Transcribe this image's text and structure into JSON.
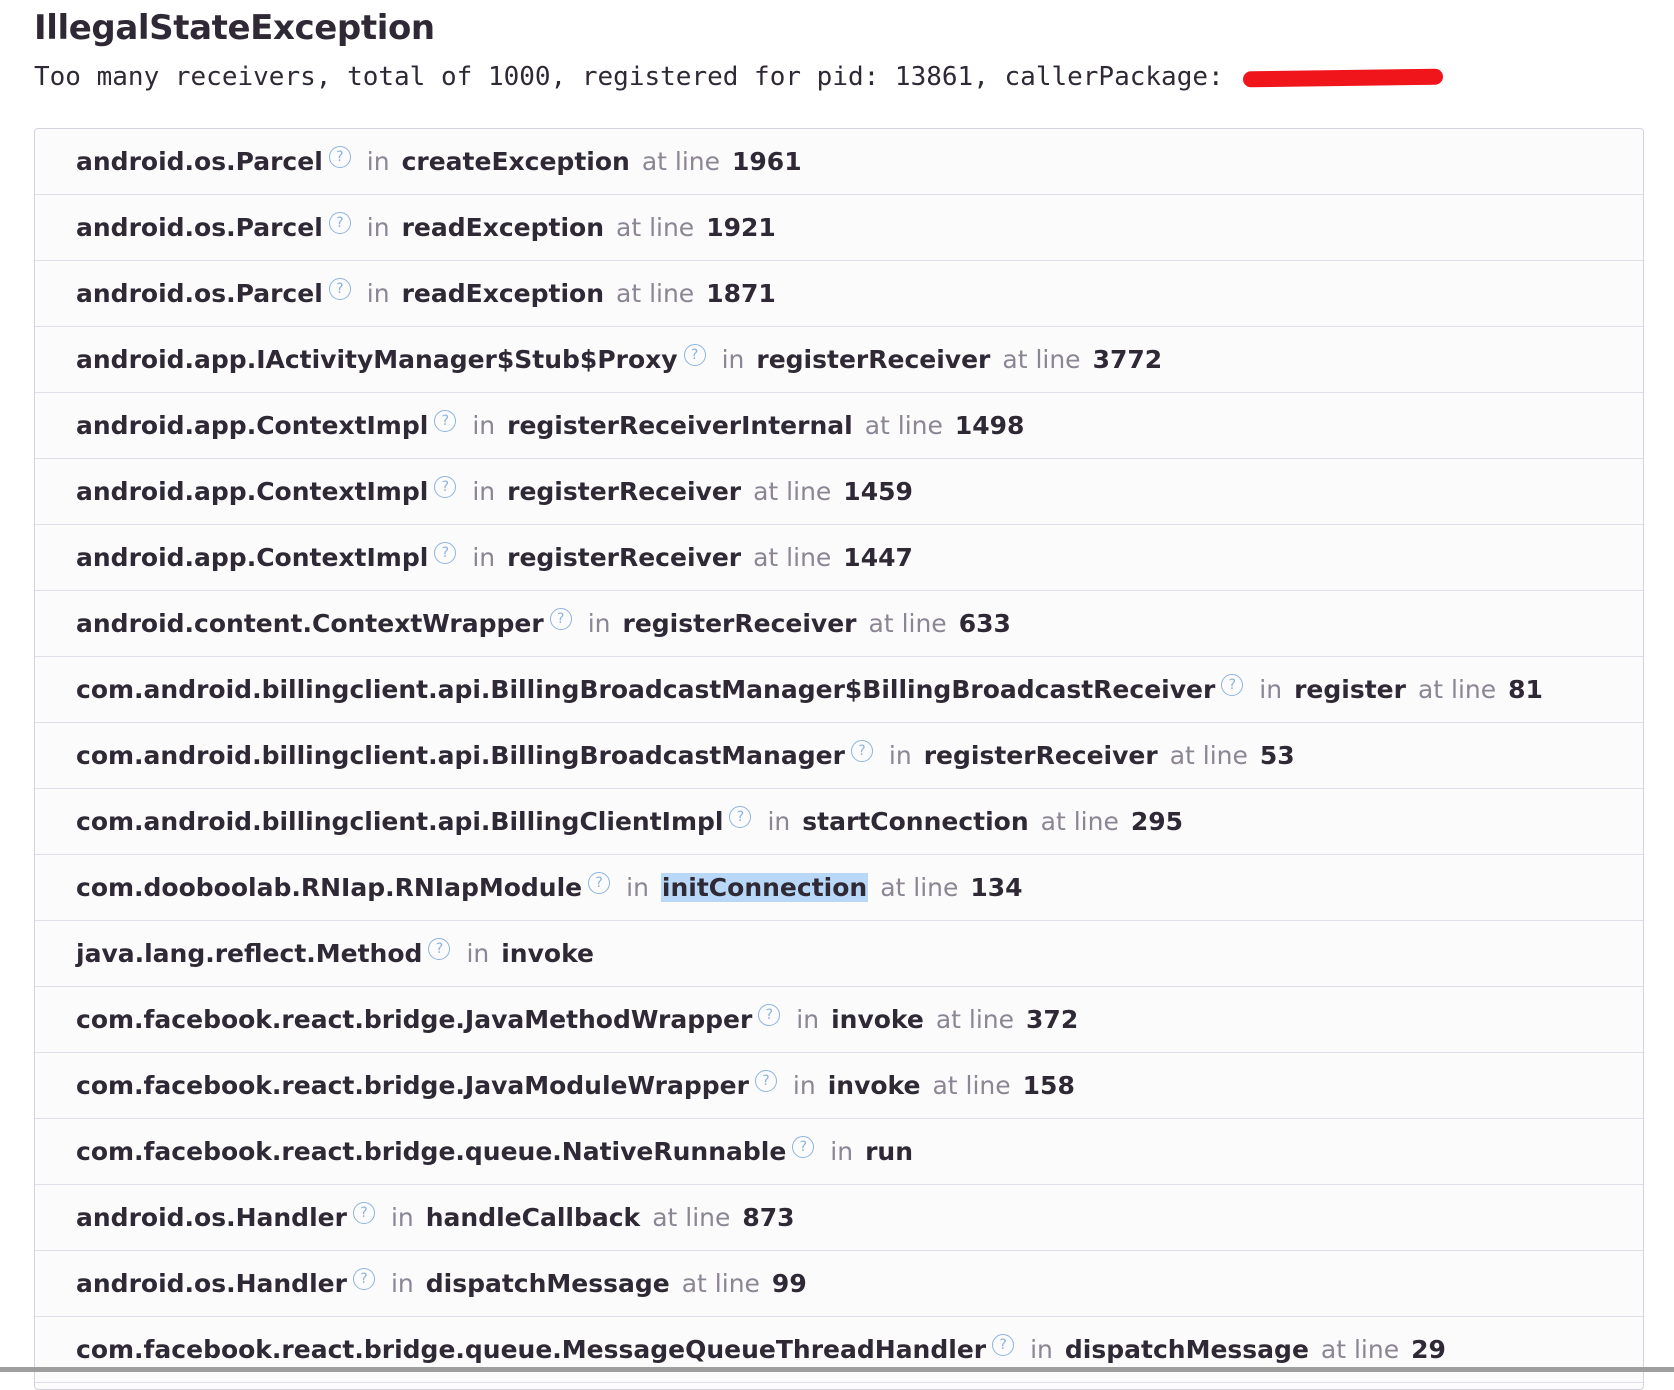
{
  "exception": {
    "type": "IllegalStateException",
    "message": "Too many receivers, total of 1000, registered for pid: 13861, callerPackage: "
  },
  "icons": {
    "help": "?",
    "help_icon_name": "question-circle-icon"
  },
  "labels": {
    "in": "in",
    "at_line": "at line"
  },
  "colors": {
    "text": "#2f2936",
    "muted": "#8b8594",
    "help_icon": "#8eb3dd",
    "selection": "#b9d8f8",
    "redaction": "#f0151b",
    "row_border": "#e2dee7"
  },
  "frames": [
    {
      "module": "android.os.Parcel",
      "function": "createException",
      "line": "1961"
    },
    {
      "module": "android.os.Parcel",
      "function": "readException",
      "line": "1921"
    },
    {
      "module": "android.os.Parcel",
      "function": "readException",
      "line": "1871"
    },
    {
      "module": "android.app.IActivityManager$Stub$Proxy",
      "function": "registerReceiver",
      "line": "3772"
    },
    {
      "module": "android.app.ContextImpl",
      "function": "registerReceiverInternal",
      "line": "1498"
    },
    {
      "module": "android.app.ContextImpl",
      "function": "registerReceiver",
      "line": "1459"
    },
    {
      "module": "android.app.ContextImpl",
      "function": "registerReceiver",
      "line": "1447"
    },
    {
      "module": "android.content.ContextWrapper",
      "function": "registerReceiver",
      "line": "633"
    },
    {
      "module": "com.android.billingclient.api.BillingBroadcastManager$BillingBroadcastReceiver",
      "function": "register",
      "line": "81"
    },
    {
      "module": "com.android.billingclient.api.BillingBroadcastManager",
      "function": "registerReceiver",
      "line": "53"
    },
    {
      "module": "com.android.billingclient.api.BillingClientImpl",
      "function": "startConnection",
      "line": "295"
    },
    {
      "module": "com.dooboolab.RNIap.RNIapModule",
      "function": "initConnection",
      "line": "134",
      "selected": true
    },
    {
      "module": "java.lang.reflect.Method",
      "function": "invoke",
      "line": null
    },
    {
      "module": "com.facebook.react.bridge.JavaMethodWrapper",
      "function": "invoke",
      "line": "372"
    },
    {
      "module": "com.facebook.react.bridge.JavaModuleWrapper",
      "function": "invoke",
      "line": "158"
    },
    {
      "module": "com.facebook.react.bridge.queue.NativeRunnable",
      "function": "run",
      "line": null
    },
    {
      "module": "android.os.Handler",
      "function": "handleCallback",
      "line": "873"
    },
    {
      "module": "android.os.Handler",
      "function": "dispatchMessage",
      "line": "99"
    },
    {
      "module": "com.facebook.react.bridge.queue.MessageQueueThreadHandler",
      "function": "dispatchMessage",
      "line": "29"
    }
  ]
}
